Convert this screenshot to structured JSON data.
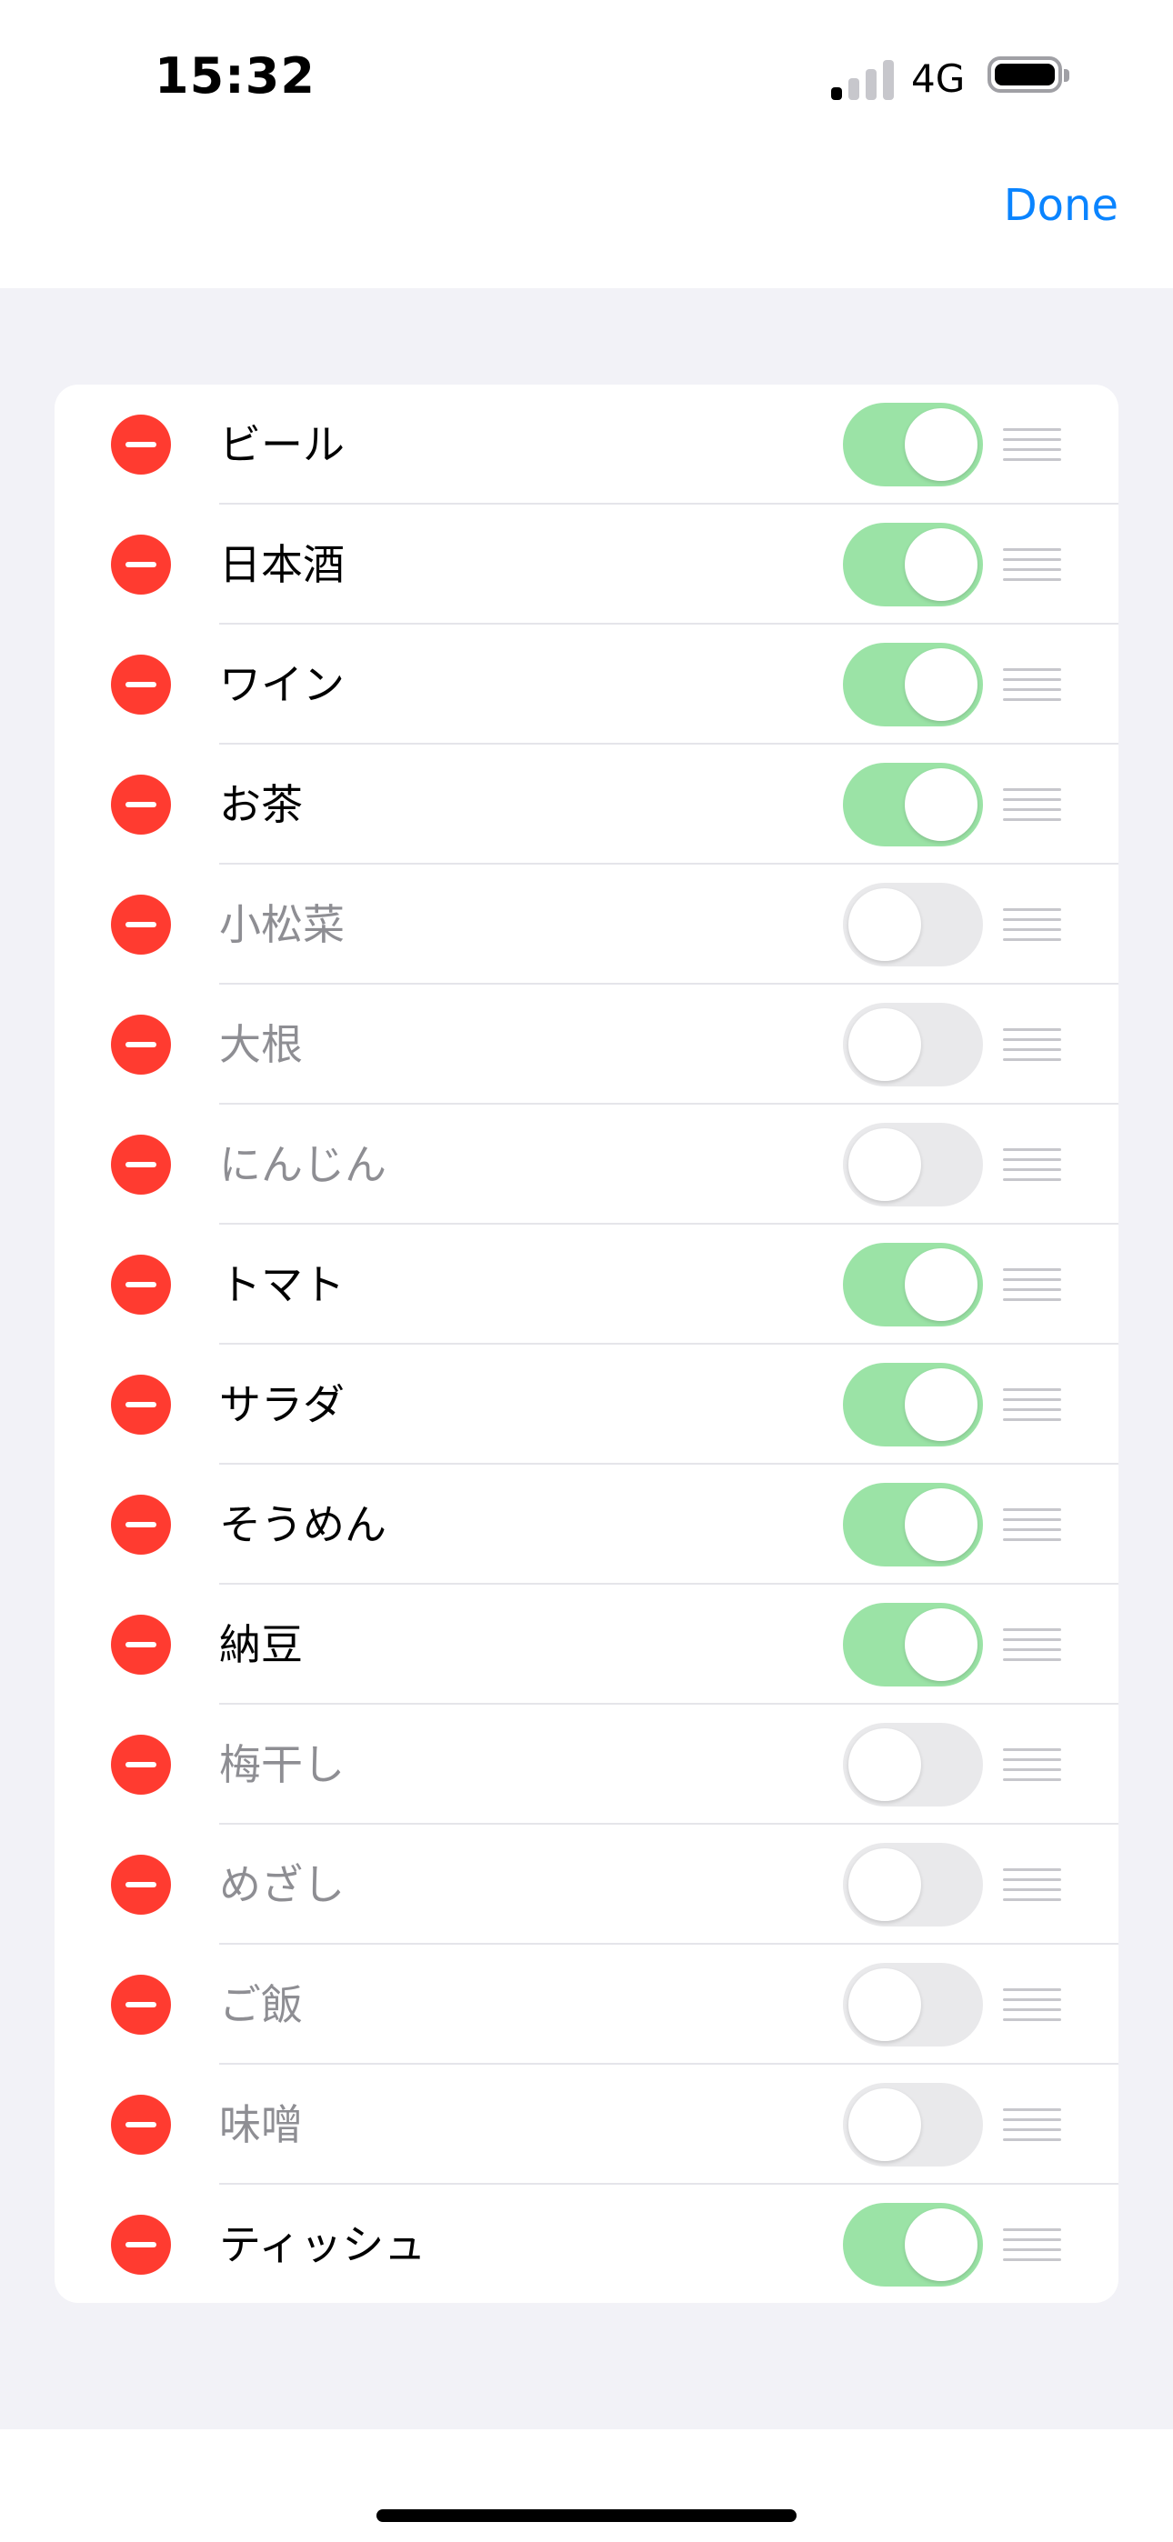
{
  "status_bar": {
    "time": "15:32",
    "network": "4G",
    "signal_bars_active": 1,
    "signal_bars_total": 4
  },
  "nav": {
    "done_label": "Done"
  },
  "colors": {
    "accent": "#0a84ff",
    "delete": "#ff3b30",
    "toggle_on": "#9be3a6",
    "toggle_off": "#e9e9eb"
  },
  "items": [
    {
      "label": "ビール",
      "enabled": true
    },
    {
      "label": "日本酒",
      "enabled": true
    },
    {
      "label": "ワイン",
      "enabled": true
    },
    {
      "label": "お茶",
      "enabled": true
    },
    {
      "label": "小松菜",
      "enabled": false
    },
    {
      "label": "大根",
      "enabled": false
    },
    {
      "label": "にんじん",
      "enabled": false
    },
    {
      "label": "トマト",
      "enabled": true
    },
    {
      "label": "サラダ",
      "enabled": true
    },
    {
      "label": "そうめん",
      "enabled": true
    },
    {
      "label": "納豆",
      "enabled": true
    },
    {
      "label": "梅干し",
      "enabled": false
    },
    {
      "label": "めざし",
      "enabled": false
    },
    {
      "label": "ご飯",
      "enabled": false
    },
    {
      "label": "味噌",
      "enabled": false
    },
    {
      "label": "ティッシュ",
      "enabled": true
    }
  ]
}
